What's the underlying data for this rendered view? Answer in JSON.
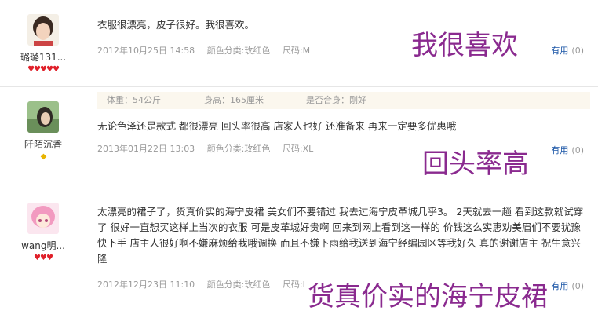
{
  "reviews": [
    {
      "username": "璐璐131...",
      "text": "衣服很漂亮，皮子很好。我很喜欢。",
      "date": "2012年10月25日 14:58",
      "color": "颜色分类:玫红色",
      "size": "尺码:M",
      "helpful_label": "有用",
      "helpful_count": "(0)"
    },
    {
      "username": "阡陌沉香",
      "body_info": {
        "weight": "体重：54公斤",
        "height": "身高：165厘米",
        "fit": "是否合身：刚好"
      },
      "text": "无论色泽还是款式 都很漂亮 回头率很高 店家人也好 还准备来 再来一定要多优惠哦",
      "date": "2013年01月22日 13:03",
      "color": "颜色分类:玫红色",
      "size": "尺码:XL",
      "helpful_label": "有用",
      "helpful_count": "(0)"
    },
    {
      "username": "wang明...",
      "text": "太漂亮的裙子了，货真价实的海宁皮裙 美女们不要错过 我去过海宁皮革城几乎3。 2天就去一趟 看到这款就试穿了 很好一直想买这样上当次的衣服 可是皮革城好贵啊 回来到网上看到这一样的 价钱这么实惠劝美眉们不要犹豫 快下手 店主人很好啊不嫌麻烦给我哦调换 而且不嫌下雨给我送到海宁经编园区等我好久 真的谢谢店主 祝生意兴隆",
      "date": "2012年12月23日 11:10",
      "color": "颜色分类:玫红色",
      "size": "尺码:L",
      "helpful_label": "有用",
      "helpful_count": "(0)"
    }
  ],
  "overlays": {
    "o1": "我很喜欢",
    "o2": "回头率高",
    "o3": "货真价实的海宁皮裙"
  },
  "colors": {
    "overlay": "#8a2a8f",
    "link": "#1a55a6",
    "meta": "#999999"
  }
}
